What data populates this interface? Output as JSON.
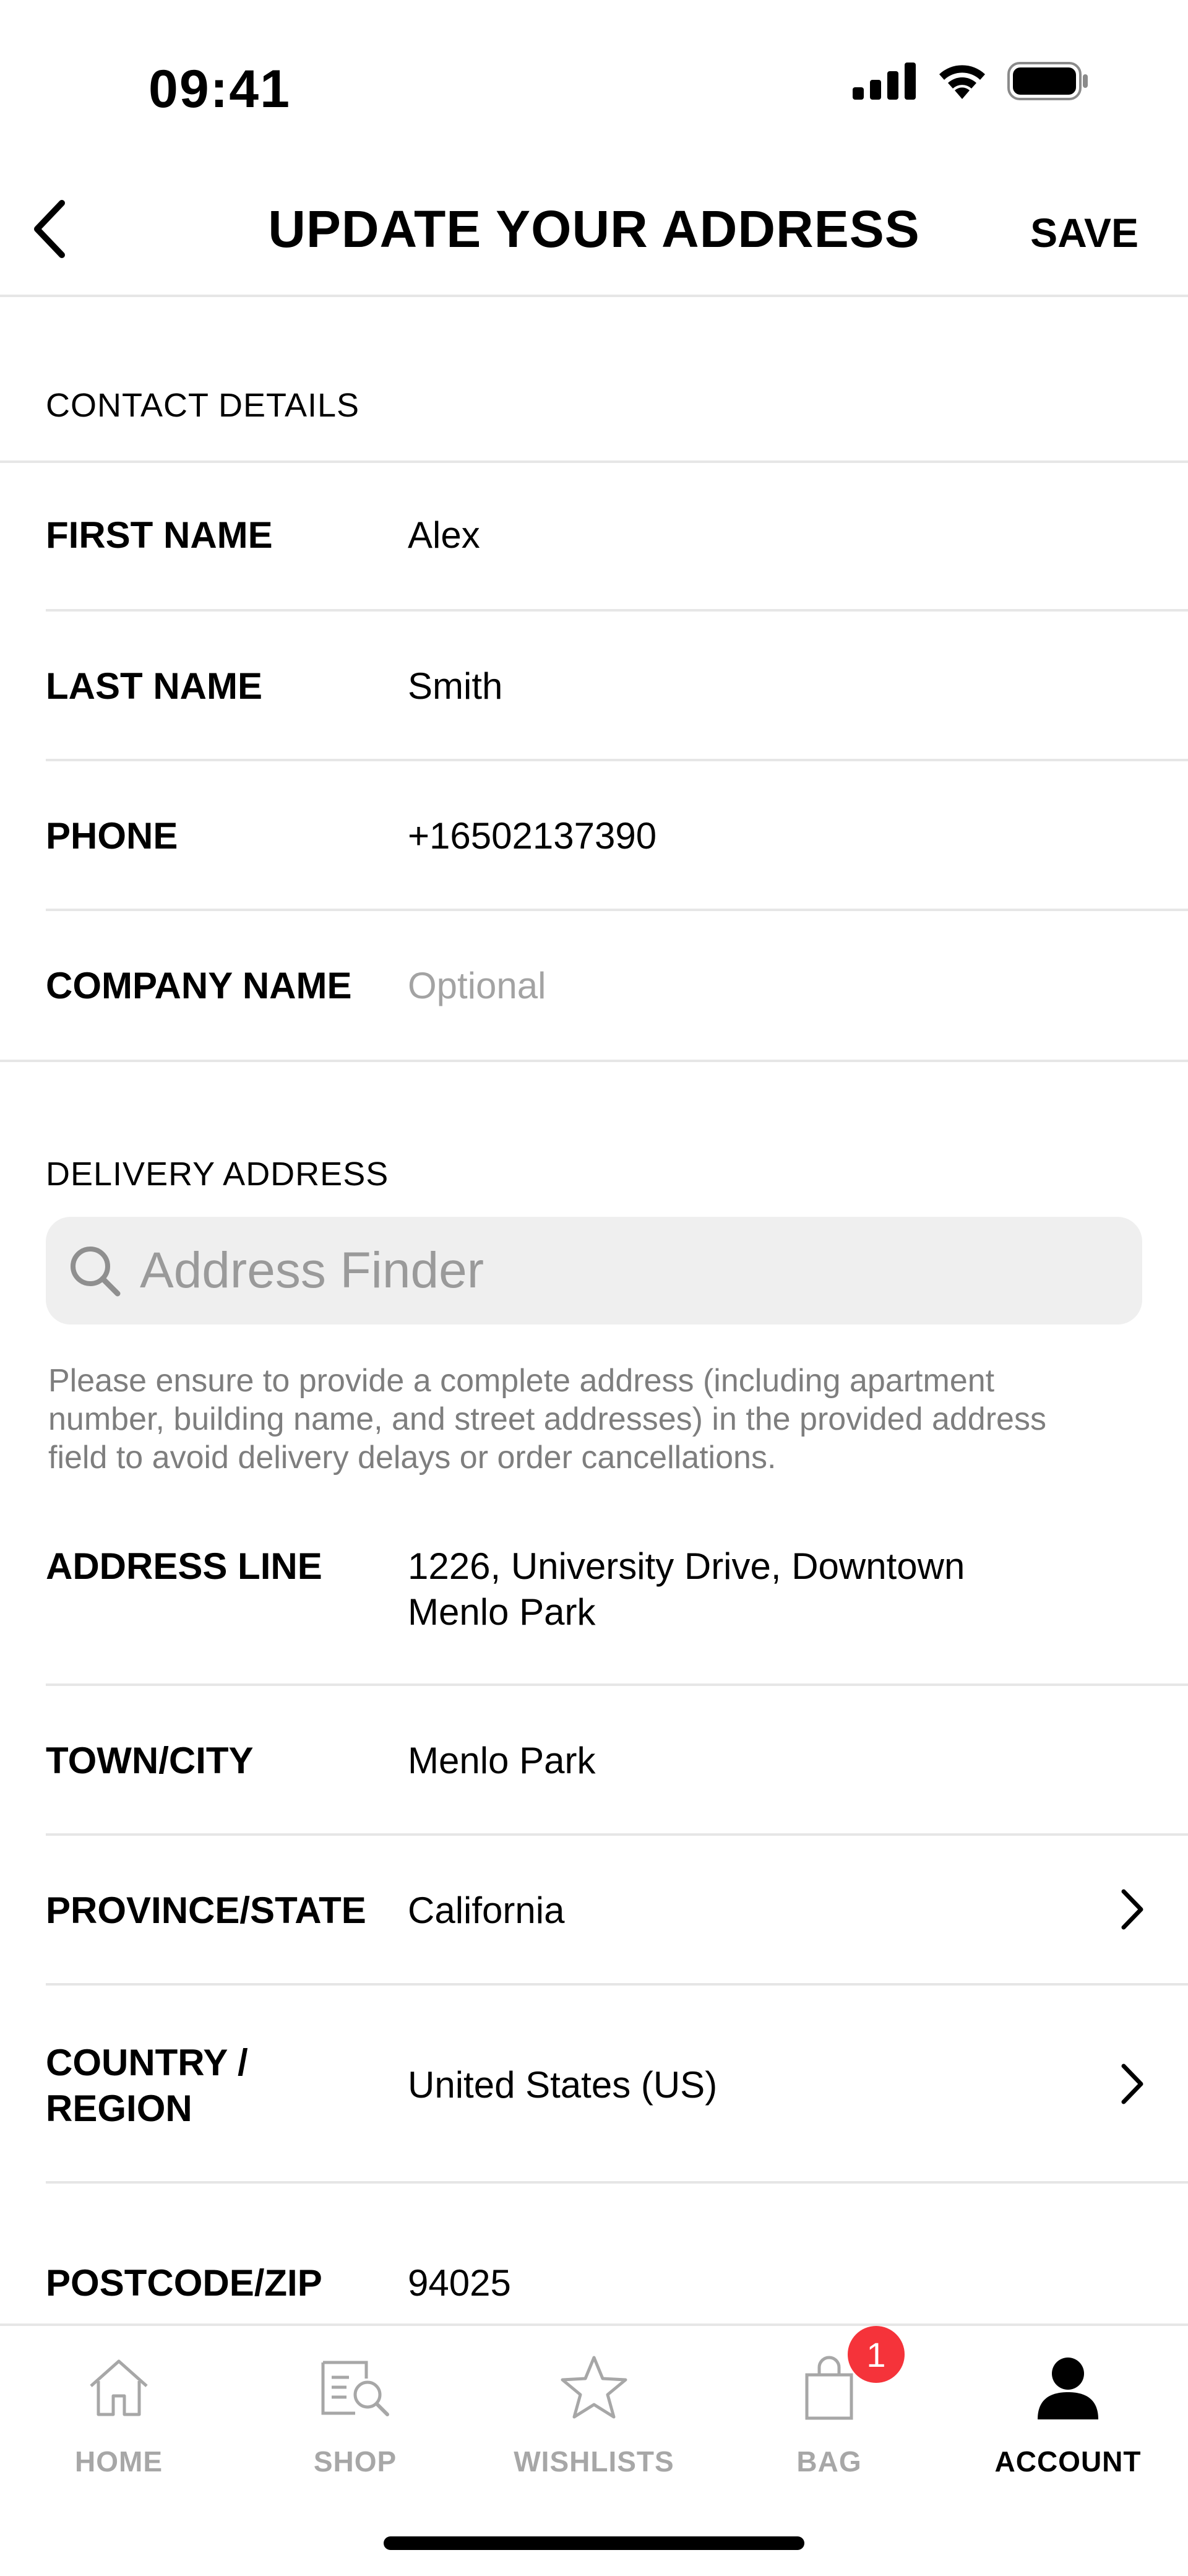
{
  "status_bar": {
    "time": "09:41",
    "icons": [
      "cellular-signal-icon",
      "wifi-icon",
      "battery-icon"
    ]
  },
  "header": {
    "title": "UPDATE YOUR ADDRESS",
    "save_label": "SAVE",
    "back_icon": "chevron-left-icon"
  },
  "contact": {
    "section_label": "CONTACT DETAILS",
    "first_name": {
      "label": "FIRST NAME",
      "value": "Alex"
    },
    "last_name": {
      "label": "LAST NAME",
      "value": "Smith"
    },
    "phone": {
      "label": "PHONE",
      "value": "+16502137390"
    },
    "company": {
      "label": "COMPANY NAME",
      "placeholder": "Optional"
    }
  },
  "delivery": {
    "section_label": "DELIVERY ADDRESS",
    "finder_placeholder": "Address Finder",
    "helper_text": "Please ensure to provide a complete address (including apartment number, building name, and street addresses) in the provided address field to avoid delivery delays or order cancellations.",
    "address_line": {
      "label": "ADDRESS LINE",
      "value": "1226, University Drive, Downtown\nMenlo Park"
    },
    "town": {
      "label": "TOWN/CITY",
      "value": "Menlo Park"
    },
    "province": {
      "label": "PROVINCE/STATE",
      "value": "California"
    },
    "country": {
      "label": "COUNTRY /\nREGION",
      "value": "United States (US)"
    },
    "postcode": {
      "label": "POSTCODE/ZIP",
      "value": "94025"
    }
  },
  "tab_bar": {
    "items": [
      {
        "label": "HOME",
        "icon": "home-icon"
      },
      {
        "label": "SHOP",
        "icon": "shop-icon"
      },
      {
        "label": "WISHLISTS",
        "icon": "star-icon"
      },
      {
        "label": "BAG",
        "icon": "bag-icon",
        "badge": "1"
      },
      {
        "label": "ACCOUNT",
        "icon": "account-icon",
        "active": true
      }
    ]
  },
  "colors": {
    "divider": "#e6e6e6",
    "placeholder": "#a3a3a3",
    "finder_bg": "#efefef",
    "helper_text": "#7e7e7e",
    "tab_inactive": "#a7a7a7",
    "badge": "#f5333a"
  }
}
